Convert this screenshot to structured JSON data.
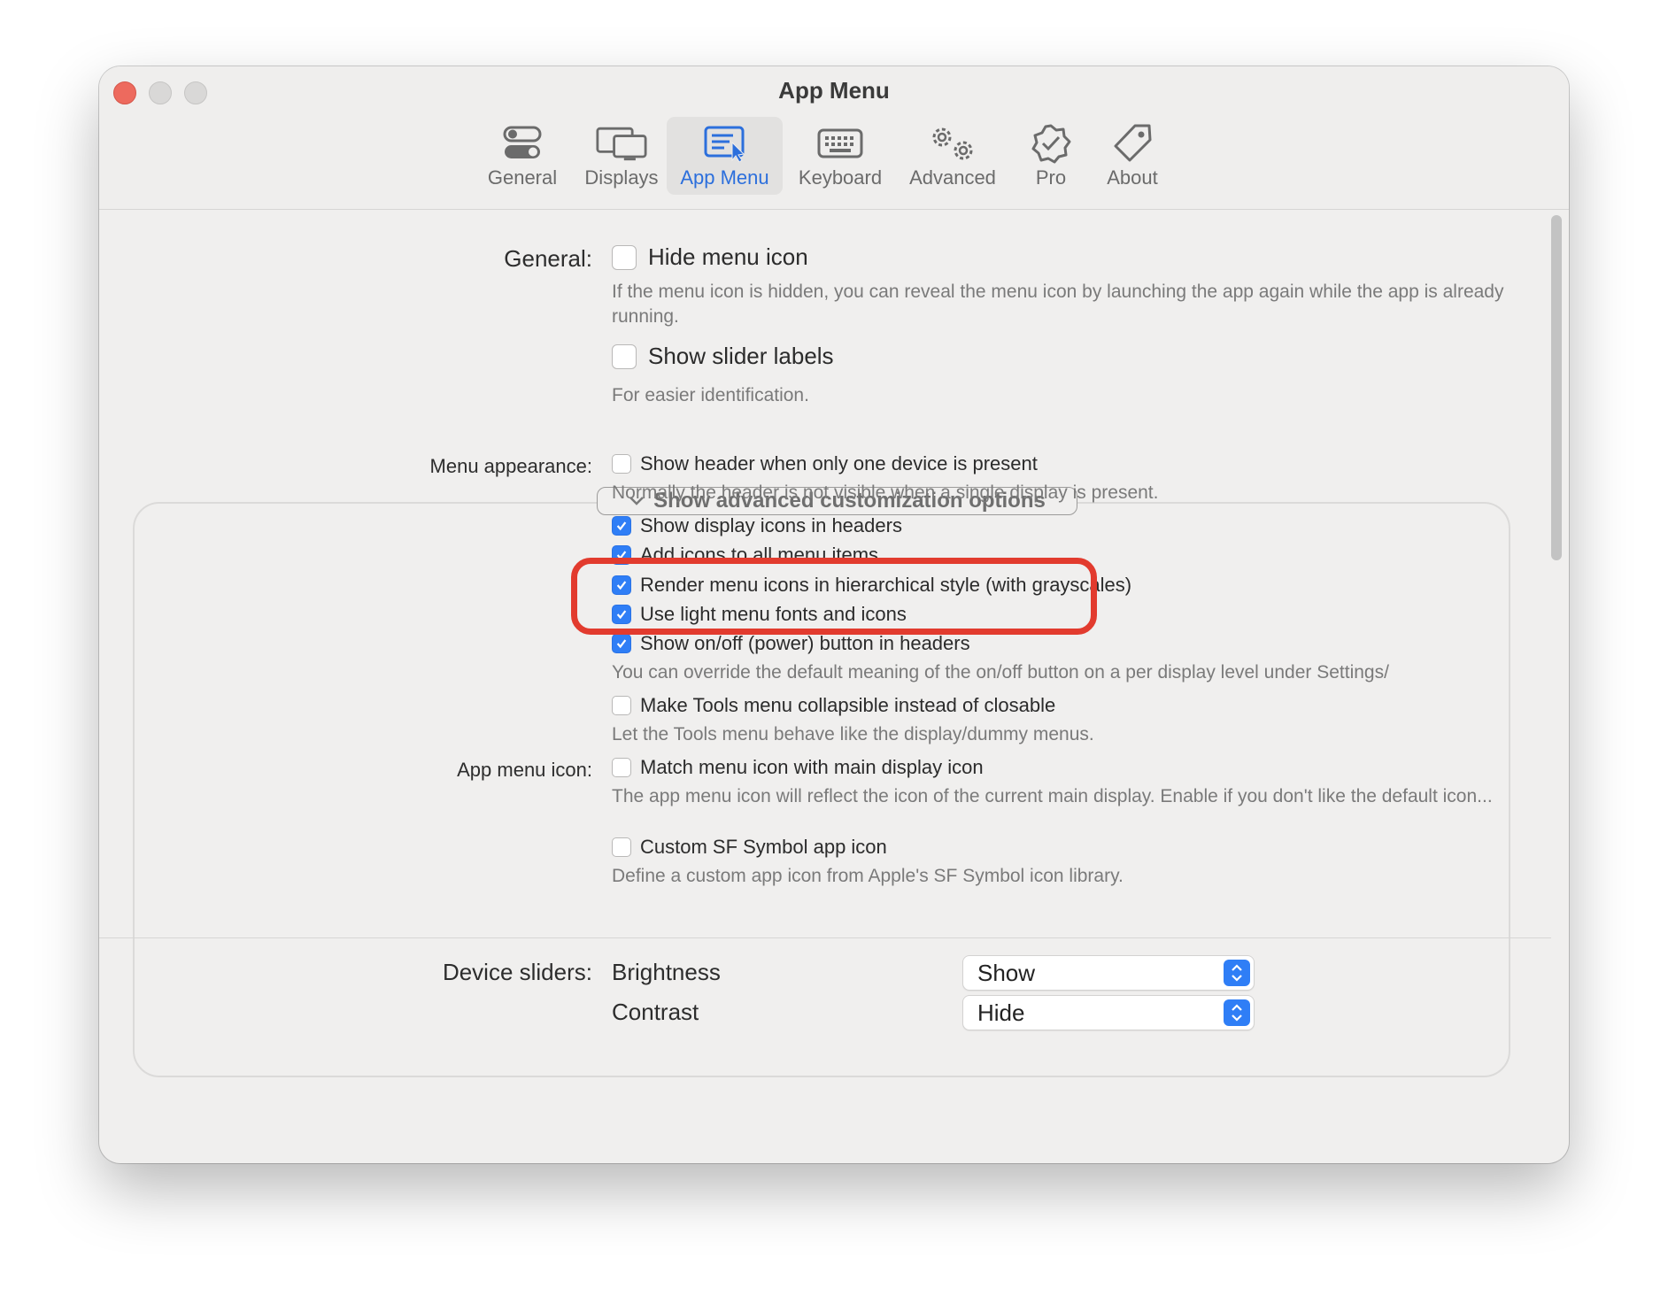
{
  "window": {
    "title": "App Menu"
  },
  "tabs": [
    {
      "label": "General",
      "icon": "toggles-icon"
    },
    {
      "label": "Displays",
      "icon": "displays-icon"
    },
    {
      "label": "App Menu",
      "icon": "app-menu-icon",
      "active": true
    },
    {
      "label": "Keyboard",
      "icon": "keyboard-icon"
    },
    {
      "label": "Advanced",
      "icon": "gears-icon"
    },
    {
      "label": "Pro",
      "icon": "checkmark-seal-icon"
    },
    {
      "label": "About",
      "icon": "tag-icon"
    }
  ],
  "general": {
    "label": "General:",
    "hide_menu_icon": {
      "label": "Hide menu icon",
      "checked": false
    },
    "hide_menu_icon_note": "If the menu icon is hidden, you can reveal the menu icon by launching the app again while the app is already running.",
    "show_slider_labels": {
      "label": "Show slider labels",
      "checked": false
    },
    "show_slider_labels_note": "For easier identification."
  },
  "advanced_toggle": {
    "label": "Show advanced customization options"
  },
  "menu_appearance": {
    "label": "Menu appearance:",
    "show_header": {
      "label": "Show header when only one device is present",
      "checked": false
    },
    "show_header_note": "Normally the header is not visible when a single display is present.",
    "display_icons": {
      "label": "Show display icons in headers",
      "checked": true
    },
    "add_icons": {
      "label": "Add icons to all menu items",
      "checked": true
    },
    "hierarchical": {
      "label": "Render menu icons in hierarchical style (with grayscales)",
      "checked": true
    },
    "light_fonts": {
      "label": "Use light menu fonts and icons",
      "checked": true
    },
    "power_button": {
      "label": "Show on/off (power) button in headers",
      "checked": true
    },
    "power_button_note": "You can override the default meaning of the on/off button on a per display level under Settings/",
    "tools_collapsible": {
      "label": "Make Tools menu collapsible instead of closable",
      "checked": false
    },
    "tools_note": "Let the Tools menu behave like the display/dummy menus."
  },
  "app_menu_icon": {
    "label": "App menu icon:",
    "match_icon": {
      "label": "Match menu icon with main display icon",
      "checked": false
    },
    "match_icon_note": "The app menu icon will reflect the icon of the current main display. Enable if you don't like the default icon...",
    "custom_symbol": {
      "label": "Custom SF Symbol app icon",
      "checked": false
    },
    "custom_symbol_note": "Define a custom app icon from Apple's SF Symbol icon library."
  },
  "device_sliders": {
    "label": "Device sliders:",
    "rows": [
      {
        "name": "Brightness",
        "value": "Show"
      },
      {
        "name": "Contrast",
        "value": "Hide"
      }
    ]
  },
  "colors": {
    "accent": "#2f7ef6",
    "highlight": "#e23b2e"
  }
}
